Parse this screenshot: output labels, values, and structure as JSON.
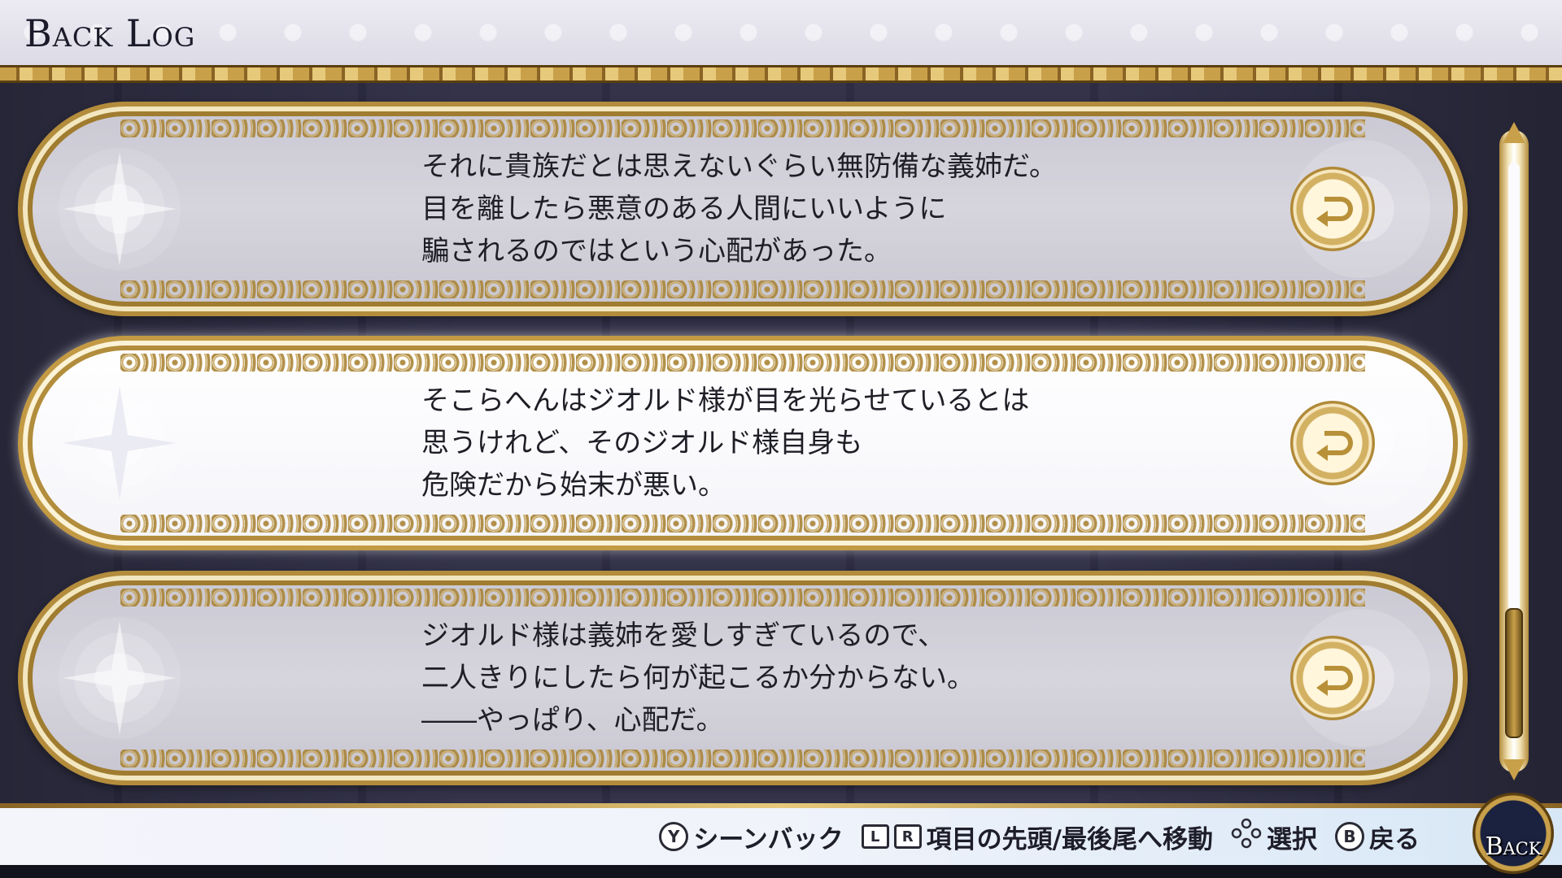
{
  "header": {
    "title": "Back Log"
  },
  "entries": [
    {
      "text": "それに貴族だとは思えないぐらい無防備な義姉だ。\n目を離したら悪意のある人間にいいように\n騙されるのではという心配があった。",
      "selected": false
    },
    {
      "text": "そこらへんはジオルド様が目を光らせているとは\n思うけれど、そのジオルド様自身も\n危険だから始末が悪い。",
      "selected": true
    },
    {
      "text": "ジオルド様は義姉を愛しすぎているので、\n二人きりにしたら何が起こるか分からない。\n――やっぱり、心配だ。",
      "selected": false
    }
  ],
  "scrollbar": {
    "position": 0.85
  },
  "footer": {
    "hints": [
      {
        "keys": [
          "Y"
        ],
        "label": "シーンバック"
      },
      {
        "keys": [
          "L",
          "R"
        ],
        "label": "項目の先頭/最後尾へ移動"
      },
      {
        "keys": [
          "dpad"
        ],
        "label": "選択"
      },
      {
        "keys": [
          "B"
        ],
        "label": "戻る"
      }
    ],
    "back_badge": "Back"
  },
  "colors": {
    "gold": "#c9a04a",
    "panel": "#cfcdd7",
    "selected_panel": "#ffffff",
    "text": "#1e1e26"
  }
}
